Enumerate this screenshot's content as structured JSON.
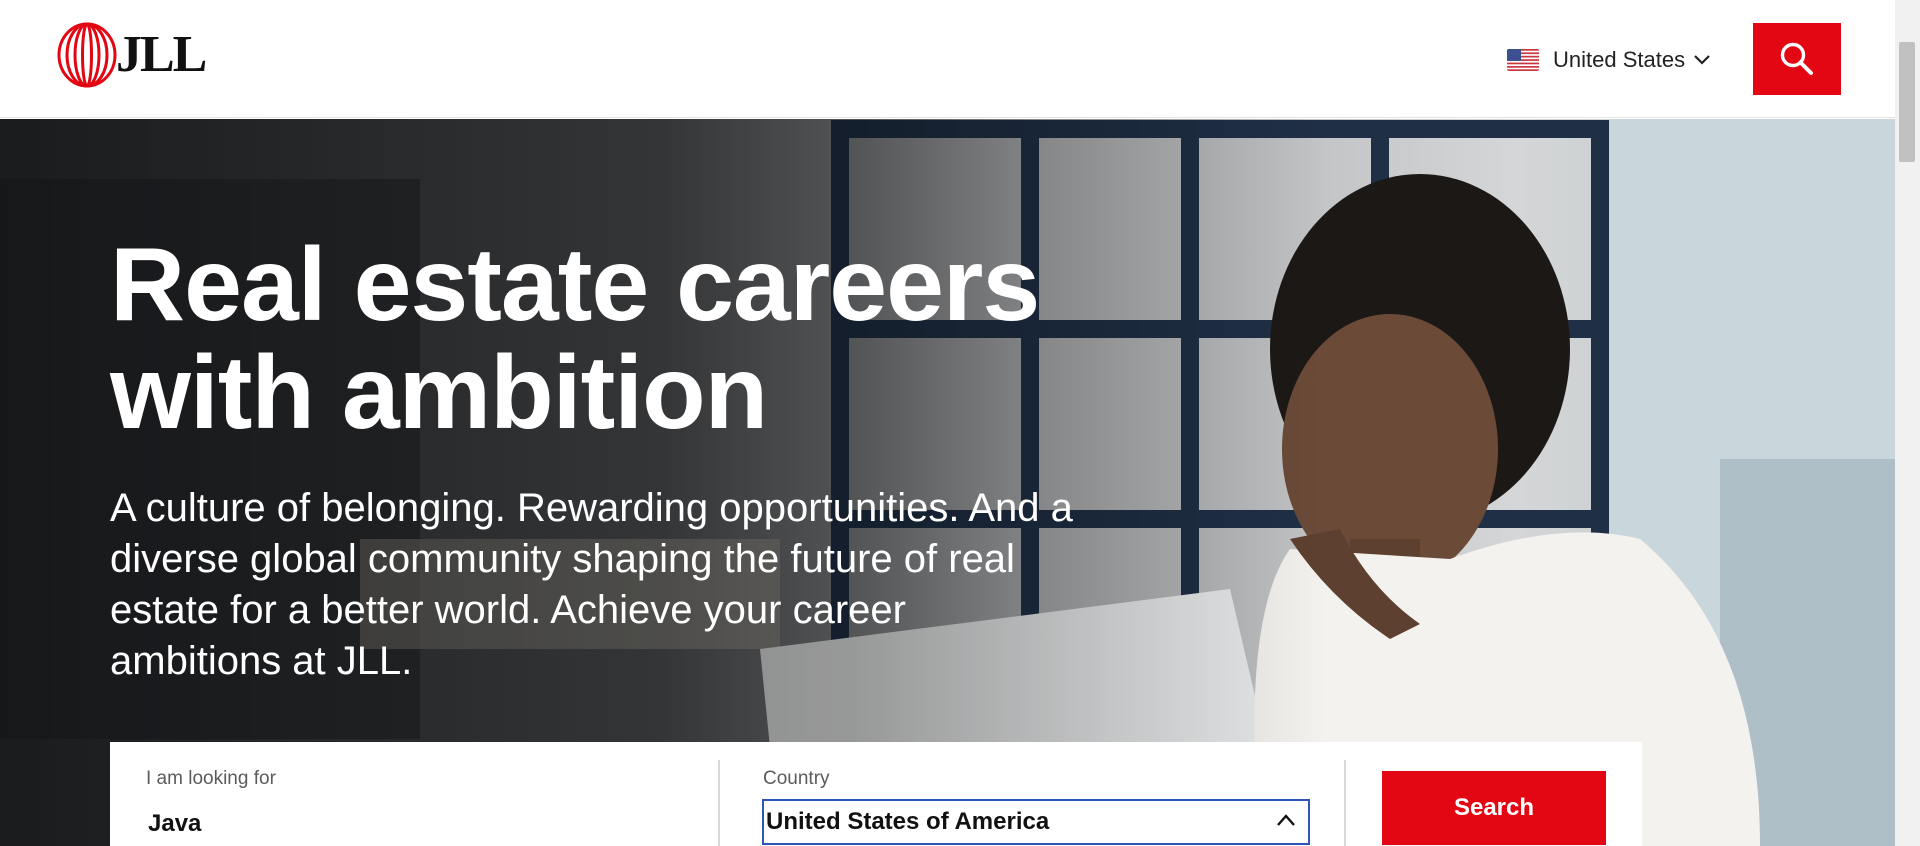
{
  "header": {
    "logo_text": "JLL",
    "country_selector": {
      "label": "United States",
      "flag_icon": "us-flag-icon",
      "chevron_icon": "chevron-down-icon"
    },
    "search_icon": "search-icon"
  },
  "hero": {
    "title_line1": "Real estate careers",
    "title_line2": "with ambition",
    "subtitle": "A culture of belonging. Rewarding opportunities. And a diverse global community shaping the future of real estate for a better world. Achieve your career ambitions at JLL."
  },
  "search_panel": {
    "keyword_label": "I am looking for",
    "keyword_value": "Java",
    "country_label": "Country",
    "country_value": "United States of America",
    "search_button": "Search"
  },
  "colors": {
    "brand_red": "#e30613",
    "focus_blue": "#2e55b8"
  }
}
